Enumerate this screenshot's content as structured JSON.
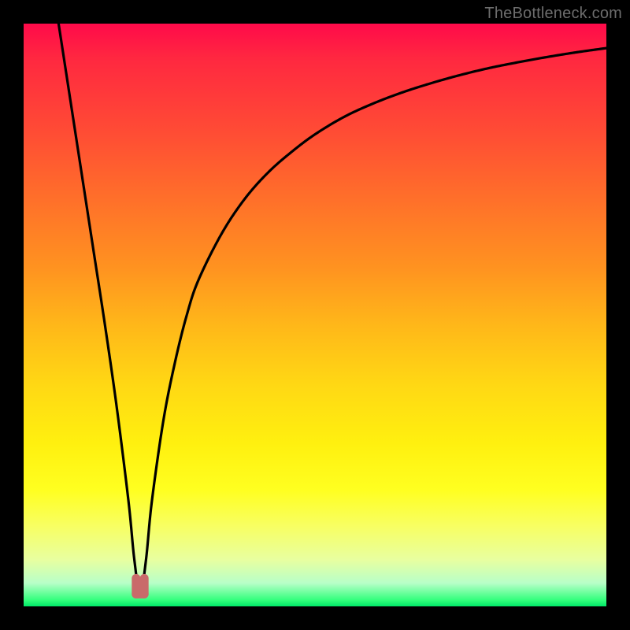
{
  "watermark": {
    "text": "TheBottleneck.com"
  },
  "colors": {
    "frame": "#000000",
    "curve": "#000000",
    "marker_fill": "#c96a6a",
    "marker_stroke": "#c96a6a"
  },
  "chart_data": {
    "type": "line",
    "title": "",
    "xlabel": "",
    "ylabel": "",
    "xlim": [
      0,
      100
    ],
    "ylim": [
      0,
      100
    ],
    "grid": false,
    "legend": false,
    "series": [
      {
        "name": "curve",
        "x": [
          6,
          8,
          10,
          12,
          14,
          16,
          18,
          19,
          20,
          21,
          22,
          24,
          26,
          28,
          30,
          34,
          38,
          42,
          46,
          50,
          55,
          60,
          65,
          70,
          75,
          80,
          85,
          90,
          95,
          100
        ],
        "y": [
          100,
          87,
          74,
          61,
          48,
          34,
          18,
          8,
          2,
          8,
          18,
          32,
          42,
          50,
          56,
          64,
          70,
          74.5,
          78,
          81,
          84,
          86.3,
          88.2,
          89.8,
          91.2,
          92.4,
          93.4,
          94.3,
          95.1,
          95.8
        ]
      }
    ],
    "markers": [
      {
        "name": "min-left",
        "x": 19.3,
        "y": 3.2
      },
      {
        "name": "min-right",
        "x": 20.7,
        "y": 3.2
      }
    ],
    "annotations": []
  }
}
